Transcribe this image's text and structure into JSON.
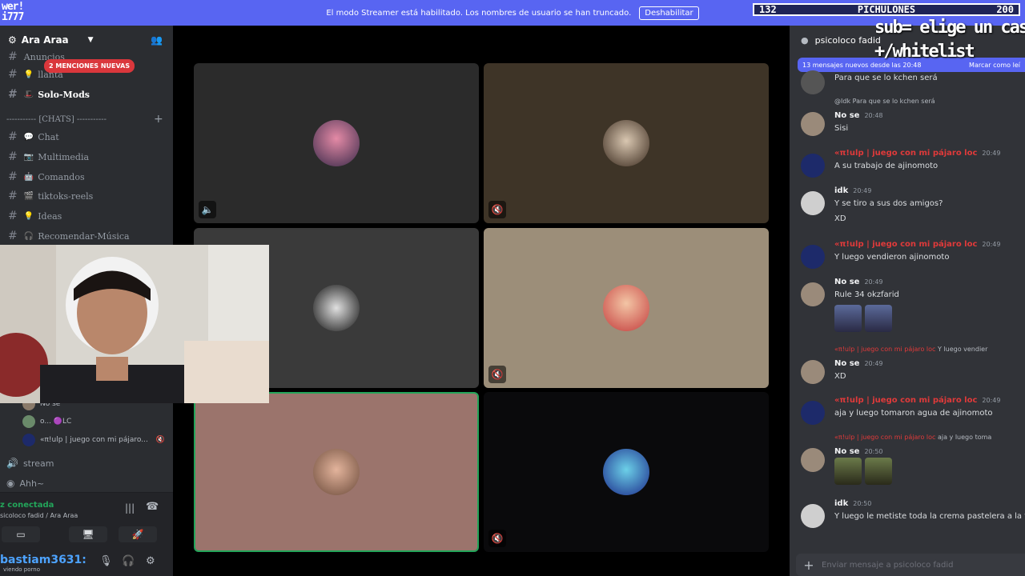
{
  "banner": {
    "message": "El modo Streamer está habilitado. Los nombres de usuario se han truncado.",
    "button": "Deshabilitar",
    "logo_line1": "wer!",
    "logo_line2": "i777"
  },
  "score": {
    "left": "132",
    "title": "PICHULONES",
    "right": "200"
  },
  "server": {
    "name": "Ara Araa"
  },
  "mentions_badge": "2 MENCIONES NUEVAS",
  "channels_top": [
    {
      "name": "Anuncios"
    },
    {
      "name": "llanta"
    },
    {
      "name": "Solo-Mods"
    }
  ],
  "category": "----------- [CHATS] -----------",
  "channels": [
    {
      "name": "Chat",
      "emoji": "💬"
    },
    {
      "name": "Multimedia",
      "emoji": "📷"
    },
    {
      "name": "Comandos",
      "emoji": "🤖"
    },
    {
      "name": "tiktoks-reels",
      "emoji": "🎬"
    },
    {
      "name": "Ideas",
      "emoji": "💡"
    },
    {
      "name": "Recomendar-Música",
      "emoji": "🎧"
    }
  ],
  "voice_users": [
    {
      "name": "No se"
    },
    {
      "name": "o... 🟣LC"
    },
    {
      "name": "«π!ulp | juego con mi pájaro..."
    }
  ],
  "voice_channels": [
    {
      "name": "stream"
    },
    {
      "name": "Ahh~"
    }
  ],
  "voice_panel": {
    "status": "z conectada",
    "location": "sicoloco fadid / Ara Araa"
  },
  "user": {
    "name": "bastiam3631:",
    "status": "viendo porno"
  },
  "chat": {
    "channel": "psicoloco fadid",
    "overlay_line1": "sub= elige un castigo",
    "overlay_line2": "+/whitelist",
    "new_messages": "13 mensajes nuevos desde las 20:48",
    "mark_read": "Marcar como leí",
    "placeholder": "Enviar mensaje a psicoloco fadid"
  },
  "messages": [
    {
      "text1": "Para que se lo kchen será"
    },
    {
      "reply_name": "@Idk",
      "reply_text": "Para que se lo kchen será",
      "name": "No se",
      "time": "20:48",
      "text1": "Sisi"
    },
    {
      "name": "«π!ulp | juego con mi pájaro loc",
      "time": "20:49",
      "text1": "A su trabajo de ajinomoto"
    },
    {
      "name": "idk",
      "time": "20:49",
      "text1": "Y se tiro a sus dos amigos?",
      "text2": "XD"
    },
    {
      "name": "«π!ulp | juego con mi pájaro loc",
      "time": "20:49",
      "text1": "Y luego vendieron ajinomoto"
    },
    {
      "name": "No se",
      "time": "20:49",
      "text1": "Rule 34 okzfarid"
    },
    {
      "reply_name": "«π!ulp | juego con mi pájaro loc",
      "reply_text": "Y luego vendier",
      "name": "No se",
      "time": "20:49",
      "text1": "XD"
    },
    {
      "name": "«π!ulp | juego con mi pájaro loc",
      "time": "20:49",
      "text1": "aja y luego tomaron agua de ajinomoto"
    },
    {
      "reply_name": "«π!ulp | juego con mi pájaro loc",
      "reply_text": "aja y luego toma",
      "name": "No se",
      "time": "20:50"
    },
    {
      "name": "idk",
      "time": "20:50",
      "text1": "Y luego le metiste toda la crema pastelera a la fla"
    }
  ]
}
